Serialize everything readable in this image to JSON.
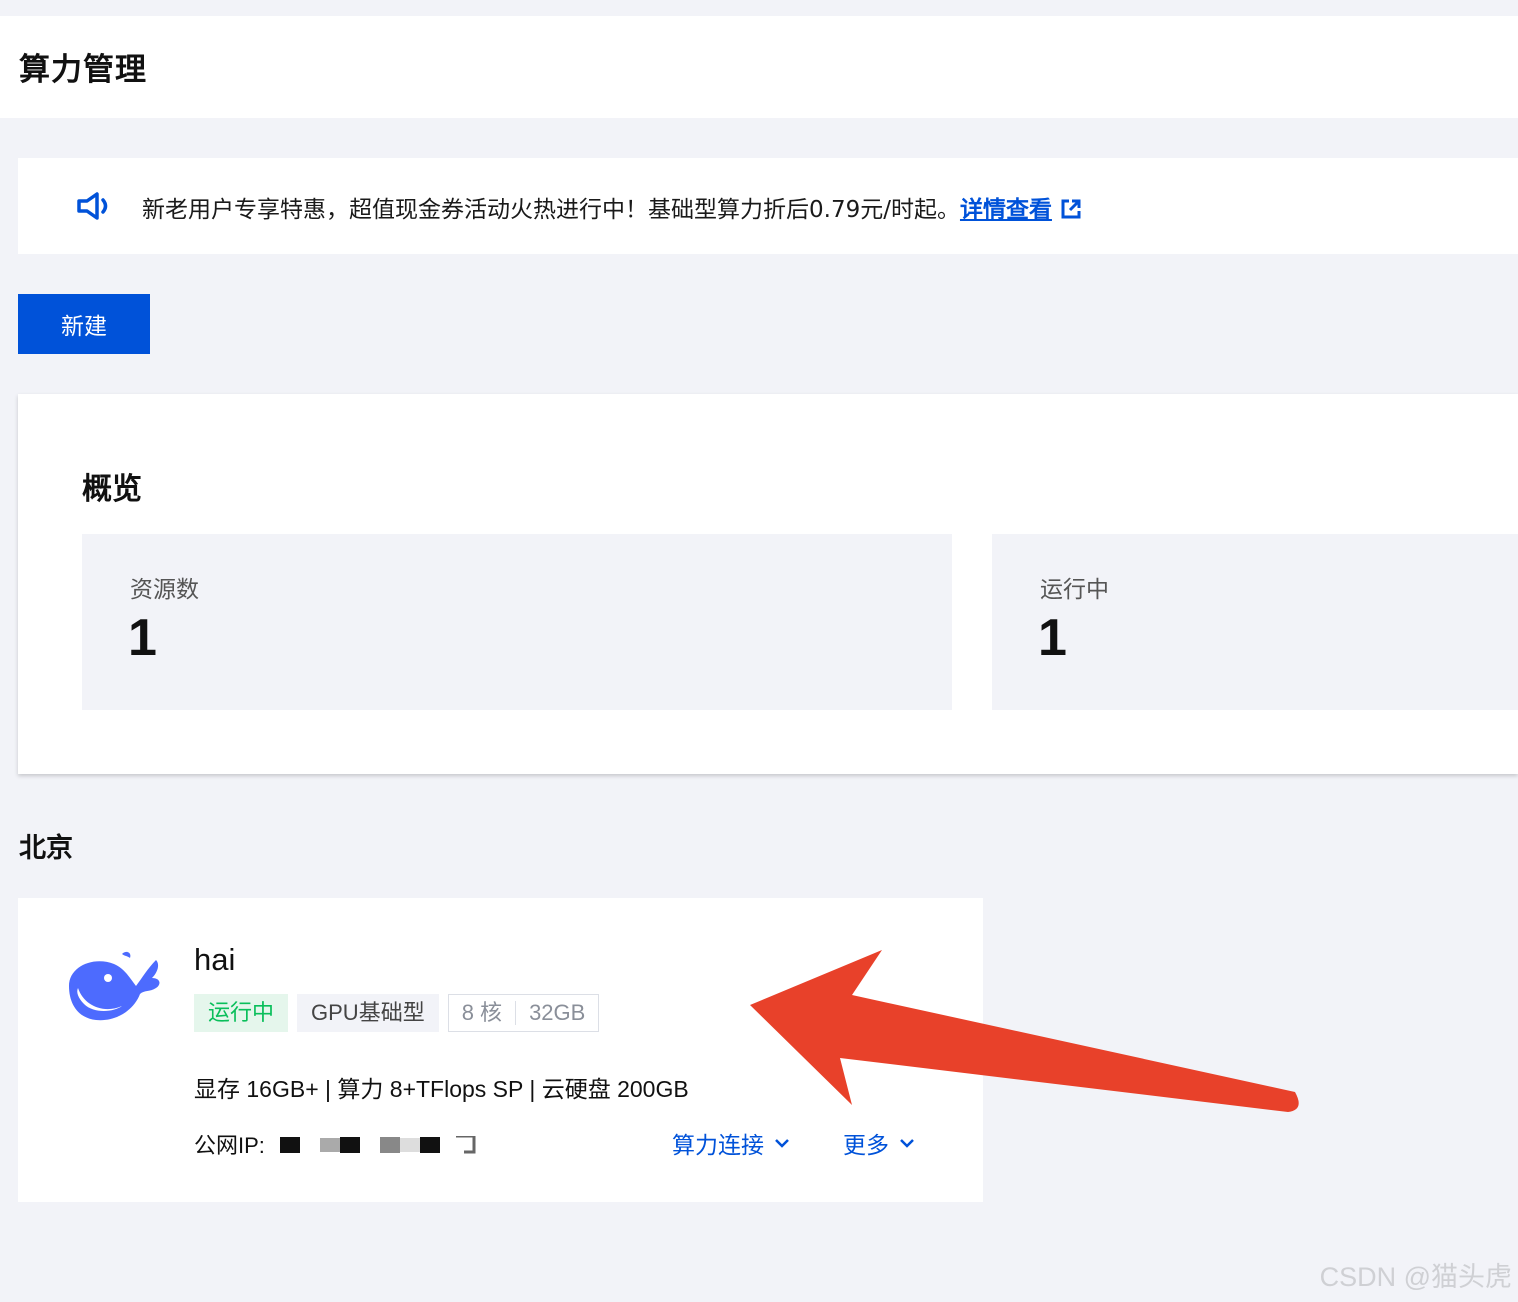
{
  "header": {
    "title": "算力管理"
  },
  "banner": {
    "icon": "speaker-icon",
    "text": "新老用户专享特惠，超值现金券活动火热进行中！基础型算力折后0.79元/时起。",
    "link_label": "详情查看",
    "link_icon": "external-link-icon"
  },
  "toolbar": {
    "new_label": "新建"
  },
  "overview": {
    "title": "概览",
    "stats": [
      {
        "label": "资源数",
        "value": "1"
      },
      {
        "label": "运行中",
        "value": "1"
      }
    ]
  },
  "region": {
    "name": "北京",
    "instance": {
      "logo": "whale-logo-icon",
      "name": "hai",
      "status": "运行中",
      "type": "GPU基础型",
      "cores": "8 核",
      "memory": "32GB",
      "specs": "显存 16GB+ | 算力 8+TFlops SP | 云硬盘 200GB",
      "ip_label": "公网IP:",
      "actions": [
        {
          "label": "算力连接"
        },
        {
          "label": "更多"
        }
      ]
    }
  },
  "colors": {
    "accent": "#0052d9",
    "running": "#0abf5b",
    "annotation_arrow": "#e8412a"
  },
  "watermark": "CSDN @猫头虎"
}
